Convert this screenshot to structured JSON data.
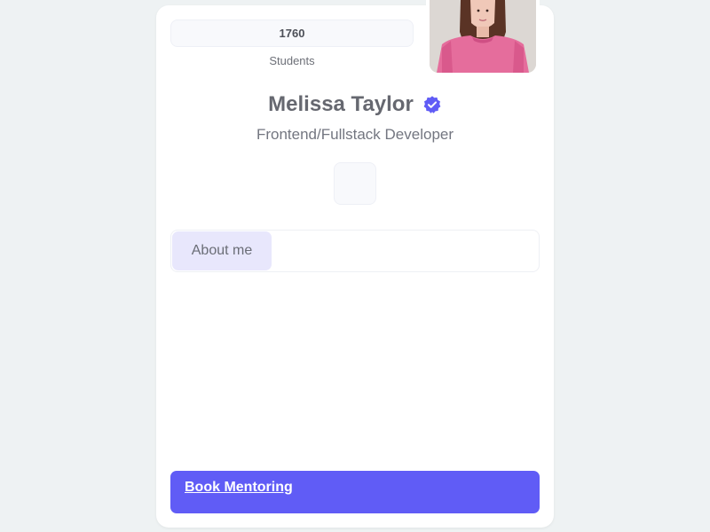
{
  "profile": {
    "stat_value": "1760",
    "stat_label": "Students",
    "name": "Melissa Taylor",
    "role": "Frontend/Fullstack Developer",
    "verified_icon": "verified-badge-icon"
  },
  "tabs": [
    {
      "label": "About me",
      "active": true
    }
  ],
  "cta": {
    "label": "Book Mentoring"
  },
  "colors": {
    "page_background": "#eef2f3",
    "card_background": "#ffffff",
    "accent": "#605cf6",
    "tab_active_background": "#e8e7fc",
    "sweater_pink": "#e56d9c"
  }
}
